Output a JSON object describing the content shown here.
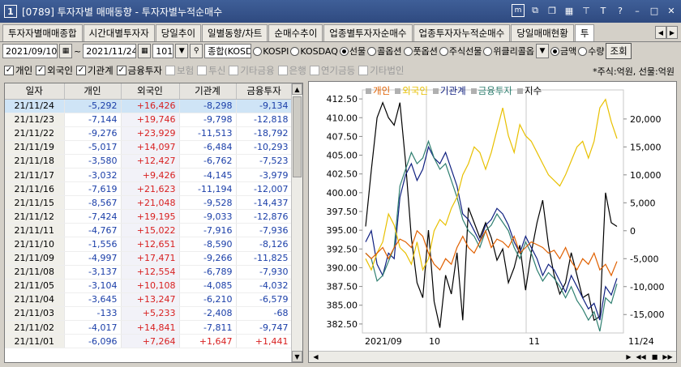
{
  "window": {
    "number": "1",
    "title": "[0789] 투자자별 매매동향 - 투자자별누적순매수",
    "icons": [
      "m-icon",
      "restore-icon",
      "copy-icon",
      "tile-icon",
      "pin-icon",
      "text-icon",
      "help-icon",
      "minimize-icon",
      "maximize-icon",
      "close-icon"
    ]
  },
  "tabs": [
    {
      "label": "투자자별매매종합",
      "active": false
    },
    {
      "label": "시간대별투자자",
      "active": false
    },
    {
      "label": "당일추이",
      "active": false
    },
    {
      "label": "일별동향/차트",
      "active": false
    },
    {
      "label": "순매수추이",
      "active": false
    },
    {
      "label": "업종별투자자순매수",
      "active": false
    },
    {
      "label": "업종투자자누적순매수",
      "active": false
    },
    {
      "label": "당일매매현황",
      "active": false
    },
    {
      "label": "투",
      "active": true
    }
  ],
  "toolbar": {
    "start_date": "2021/09/10",
    "separator": "~",
    "end_date": "2021/11/24",
    "count": "101",
    "market_select": "종합(KOSD",
    "markets": [
      {
        "label": "KOSPI",
        "selected": false
      },
      {
        "label": "KOSDAQ",
        "selected": false
      },
      {
        "label": "선물",
        "selected": true
      },
      {
        "label": "콜옵션",
        "selected": false
      },
      {
        "label": "풋옵션",
        "selected": false
      },
      {
        "label": "주식선물",
        "selected": false
      },
      {
        "label": "위클리콜옵",
        "selected": false
      }
    ],
    "units": [
      {
        "label": "금액",
        "selected": true
      },
      {
        "label": "수량",
        "selected": false
      }
    ],
    "query_button": "조회"
  },
  "filters": [
    {
      "label": "개인",
      "checked": true,
      "enabled": true
    },
    {
      "label": "외국인",
      "checked": true,
      "enabled": true
    },
    {
      "label": "기관계",
      "checked": true,
      "enabled": true
    },
    {
      "label": "금융투자",
      "checked": true,
      "enabled": true
    },
    {
      "label": "보험",
      "checked": false,
      "enabled": false
    },
    {
      "label": "투신",
      "checked": false,
      "enabled": false
    },
    {
      "label": "기타금융",
      "checked": false,
      "enabled": false
    },
    {
      "label": "은행",
      "checked": false,
      "enabled": false
    },
    {
      "label": "연기금등",
      "checked": false,
      "enabled": false
    },
    {
      "label": "기타법인",
      "checked": false,
      "enabled": false
    }
  ],
  "unit_note": "*주식:억원, 선물:억원",
  "table": {
    "headers": [
      "일자",
      "개인",
      "외국인",
      "기관계",
      "금융투자"
    ],
    "rows": [
      [
        "21/11/24",
        "-5,292",
        "+16,426",
        "-8,298",
        "-9,134"
      ],
      [
        "21/11/23",
        "-7,144",
        "+19,746",
        "-9,798",
        "-12,818"
      ],
      [
        "21/11/22",
        "-9,276",
        "+23,929",
        "-11,513",
        "-18,792"
      ],
      [
        "21/11/19",
        "-5,017",
        "+14,097",
        "-6,484",
        "-10,293"
      ],
      [
        "21/11/18",
        "-3,580",
        "+12,427",
        "-6,762",
        "-7,523"
      ],
      [
        "21/11/17",
        "-3,032",
        "+9,426",
        "-4,145",
        "-3,979"
      ],
      [
        "21/11/16",
        "-7,619",
        "+21,623",
        "-11,194",
        "-12,007"
      ],
      [
        "21/11/15",
        "-8,567",
        "+21,048",
        "-9,528",
        "-14,437"
      ],
      [
        "21/11/12",
        "-7,424",
        "+19,195",
        "-9,033",
        "-12,876"
      ],
      [
        "21/11/11",
        "-4,767",
        "+15,022",
        "-7,916",
        "-7,936"
      ],
      [
        "21/11/10",
        "-1,556",
        "+12,651",
        "-8,590",
        "-8,126"
      ],
      [
        "21/11/09",
        "-4,997",
        "+17,471",
        "-9,266",
        "-11,825"
      ],
      [
        "21/11/08",
        "-3,137",
        "+12,554",
        "-6,789",
        "-7,930"
      ],
      [
        "21/11/05",
        "-3,104",
        "+10,108",
        "-4,085",
        "-4,032"
      ],
      [
        "21/11/04",
        "-3,645",
        "+13,247",
        "-6,210",
        "-6,579"
      ],
      [
        "21/11/03",
        "-133",
        "+5,233",
        "-2,408",
        "-68"
      ],
      [
        "21/11/02",
        "-4,017",
        "+14,841",
        "-7,811",
        "-9,747"
      ],
      [
        "21/11/01",
        "-6,096",
        "+7,264",
        "+1,647",
        "+1,441"
      ]
    ]
  },
  "chart_data": {
    "type": "line",
    "legend": [
      "개인",
      "외국인",
      "기관계",
      "금융투자",
      "지수"
    ],
    "colors": {
      "개인": "#e06000",
      "외국인": "#e8c000",
      "기관계": "#102080",
      "금융투자": "#2f7f70",
      "지수": "#000000"
    },
    "left_axis": {
      "ticks": [
        "412.50",
        "410.00",
        "407.50",
        "405.00",
        "402.50",
        "400.00",
        "397.50",
        "395.00",
        "392.50",
        "390.00",
        "387.50",
        "385.00",
        "382.50"
      ],
      "ylim": [
        381.3,
        413.7
      ]
    },
    "right_axis": {
      "ticks": [
        "20,000",
        "15,000",
        "10,000",
        "5,000",
        "0",
        "-5,000",
        "-10,000",
        "-15,000"
      ],
      "ylim": [
        -18300,
        25200
      ]
    },
    "x_labels": [
      "2021/09",
      "10",
      "11",
      "11/24"
    ],
    "series": [
      {
        "name": "지수",
        "axis": "left",
        "values": [
          395.5,
          403,
          410,
          412,
          410,
          409,
          412,
          404,
          394,
          388,
          386,
          395,
          385.5,
          382,
          389,
          386.5,
          392,
          383,
          398,
          396,
          394,
          396,
          394,
          391,
          392.5,
          388,
          390,
          393,
          387,
          392,
          396,
          399,
          393,
          389,
          386.5,
          388,
          392,
          389,
          386,
          386.5,
          383,
          383.5,
          400,
          396,
          395.5
        ]
      },
      {
        "name": "기관계",
        "axis": "right",
        "values": [
          -2000,
          0,
          -6000,
          -8000,
          -4000,
          -5000,
          6000,
          10000,
          12000,
          9000,
          11000,
          15000,
          13000,
          12000,
          14000,
          11000,
          8000,
          3000,
          2000,
          0,
          -2000,
          1000,
          2000,
          4000,
          3000,
          1000,
          -2000,
          -4000,
          -1000,
          -3000,
          -5000,
          -8000,
          -6000,
          -7000,
          -9000,
          -11000,
          -8000,
          -10000,
          -12000,
          -14000,
          -13000,
          -16000,
          -10000,
          -11500,
          -8500
        ]
      },
      {
        "name": "금융투자",
        "axis": "right",
        "values": [
          -4000,
          -5000,
          -9000,
          -8000,
          -5500,
          -3000,
          8000,
          11000,
          14000,
          12000,
          13000,
          16000,
          13000,
          11000,
          12000,
          9000,
          6000,
          2000,
          0,
          -1000,
          -3000,
          0,
          1000,
          3000,
          1500,
          0,
          -3000,
          -5000,
          -2000,
          -4000,
          -7000,
          -9000,
          -7500,
          -8500,
          -10000,
          -12000,
          -10000,
          -12500,
          -14000,
          -16000,
          -14500,
          -18000,
          -12000,
          -13000,
          -9500
        ]
      },
      {
        "name": "외국인",
        "axis": "right",
        "values": [
          -5000,
          -7000,
          -4000,
          -2000,
          3000,
          1000,
          -3000,
          -4000,
          -6000,
          -2000,
          -7000,
          -5000,
          0,
          2000,
          1000,
          4000,
          6000,
          10000,
          12000,
          15000,
          14000,
          11000,
          14000,
          18000,
          22000,
          17000,
          14000,
          19000,
          17000,
          16000,
          14000,
          12000,
          10000,
          9000,
          8000,
          10000,
          12500,
          15000,
          16000,
          13000,
          16000,
          22000,
          23500,
          19500,
          16500
        ]
      },
      {
        "name": "개인",
        "axis": "right",
        "values": [
          -4000,
          -5000,
          -4000,
          -3000,
          -5000,
          -3000,
          -1500,
          -2000,
          -3000,
          0,
          -1000,
          -4000,
          -6000,
          -7000,
          -5000,
          -6000,
          -3000,
          -1000,
          -3000,
          -4000,
          -2000,
          0,
          -3000,
          -1500,
          -2000,
          -3000,
          -1000,
          -4000,
          -3000,
          -2000,
          -2500,
          -3000,
          -4000,
          -3500,
          -5000,
          -3000,
          -5500,
          -7000,
          -5000,
          -6000,
          -4000,
          -7000,
          -6000,
          -8000,
          -5500
        ]
      }
    ]
  },
  "chart_controls": [
    "scroll-left-icon",
    "scroll-right-icon",
    "rewind-icon",
    "stop-icon",
    "forward-icon"
  ]
}
